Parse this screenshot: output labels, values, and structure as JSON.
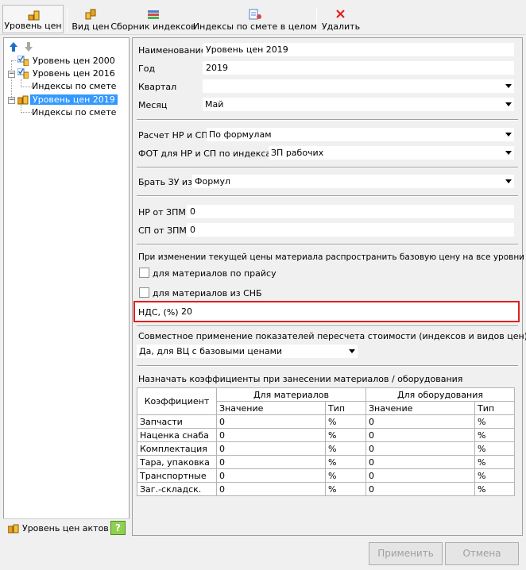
{
  "toolbar": {
    "price_level": "Уровень цен",
    "price_type": "Вид цен",
    "index_collection": "Сборник индексов",
    "indexes_by_estimate": "Индексы по смете в целом",
    "delete": "Удалить"
  },
  "tree": {
    "items": [
      {
        "label": "Уровень цен 2000"
      },
      {
        "label": "Уровень цен 2016"
      },
      {
        "label": "Индексы по смете"
      },
      {
        "label": "Уровень цен 2019"
      },
      {
        "label": "Индексы по смете"
      }
    ],
    "bottom_label": "Уровень цен актов"
  },
  "form": {
    "name_label": "Наименование",
    "name_value": "Уровень цен 2019",
    "year_label": "Год",
    "year_value": "2019",
    "quarter_label": "Квартал",
    "quarter_value": "",
    "month_label": "Месяц",
    "month_value": "Май",
    "nr_sp_calc_label": "Расчет НР и СП",
    "nr_sp_calc_value": "По формулам",
    "fot_label": "ФОТ для НР и СП по индексам",
    "fot_value": "ЗП рабочих",
    "zu_label": "Брать ЗУ из",
    "zu_value": "Формул",
    "nr_zpm_label": "НР от ЗПМ",
    "nr_zpm_value": "0",
    "sp_zpm_label": "СП от ЗПМ",
    "sp_zpm_value": "0",
    "propagate_text": "При изменении текущей цены материала распространить базовую цену на все уровни цен с",
    "chk_pricelist": "для материалов по прайсу",
    "chk_snb": "для материалов из СНБ",
    "vat_label": "НДС, (%)",
    "vat_value": "20",
    "joint_label": "Совместное применение показателей пересчета стоимости (индексов и видов цен)",
    "joint_value": "Да, для ВЦ с базовыми ценами",
    "coef_title": "Назначать коэффициенты при занесении материалов / оборудования"
  },
  "coef_table": {
    "col_coef": "Коэффициент",
    "col_materials": "Для материалов",
    "col_equipment": "Для оборудования",
    "col_value": "Значение",
    "col_type": "Тип",
    "rows": [
      {
        "name": "Запчасти",
        "m_val": "0",
        "m_type": "%",
        "e_val": "0",
        "e_type": "%"
      },
      {
        "name": "Наценка снаба",
        "m_val": "0",
        "m_type": "%",
        "e_val": "0",
        "e_type": "%"
      },
      {
        "name": "Комплектация",
        "m_val": "0",
        "m_type": "%",
        "e_val": "0",
        "e_type": "%"
      },
      {
        "name": "Тара, упаковка",
        "m_val": "0",
        "m_type": "%",
        "e_val": "0",
        "e_type": "%"
      },
      {
        "name": "Транспортные",
        "m_val": "0",
        "m_type": "%",
        "e_val": "0",
        "e_type": "%"
      },
      {
        "name": "Заг.-складск.",
        "m_val": "0",
        "m_type": "%",
        "e_val": "0",
        "e_type": "%"
      }
    ]
  },
  "buttons": {
    "apply": "Применить",
    "cancel": "Отмена"
  },
  "colors": {
    "selection": "#3399ff",
    "highlight_border": "#e02020"
  }
}
